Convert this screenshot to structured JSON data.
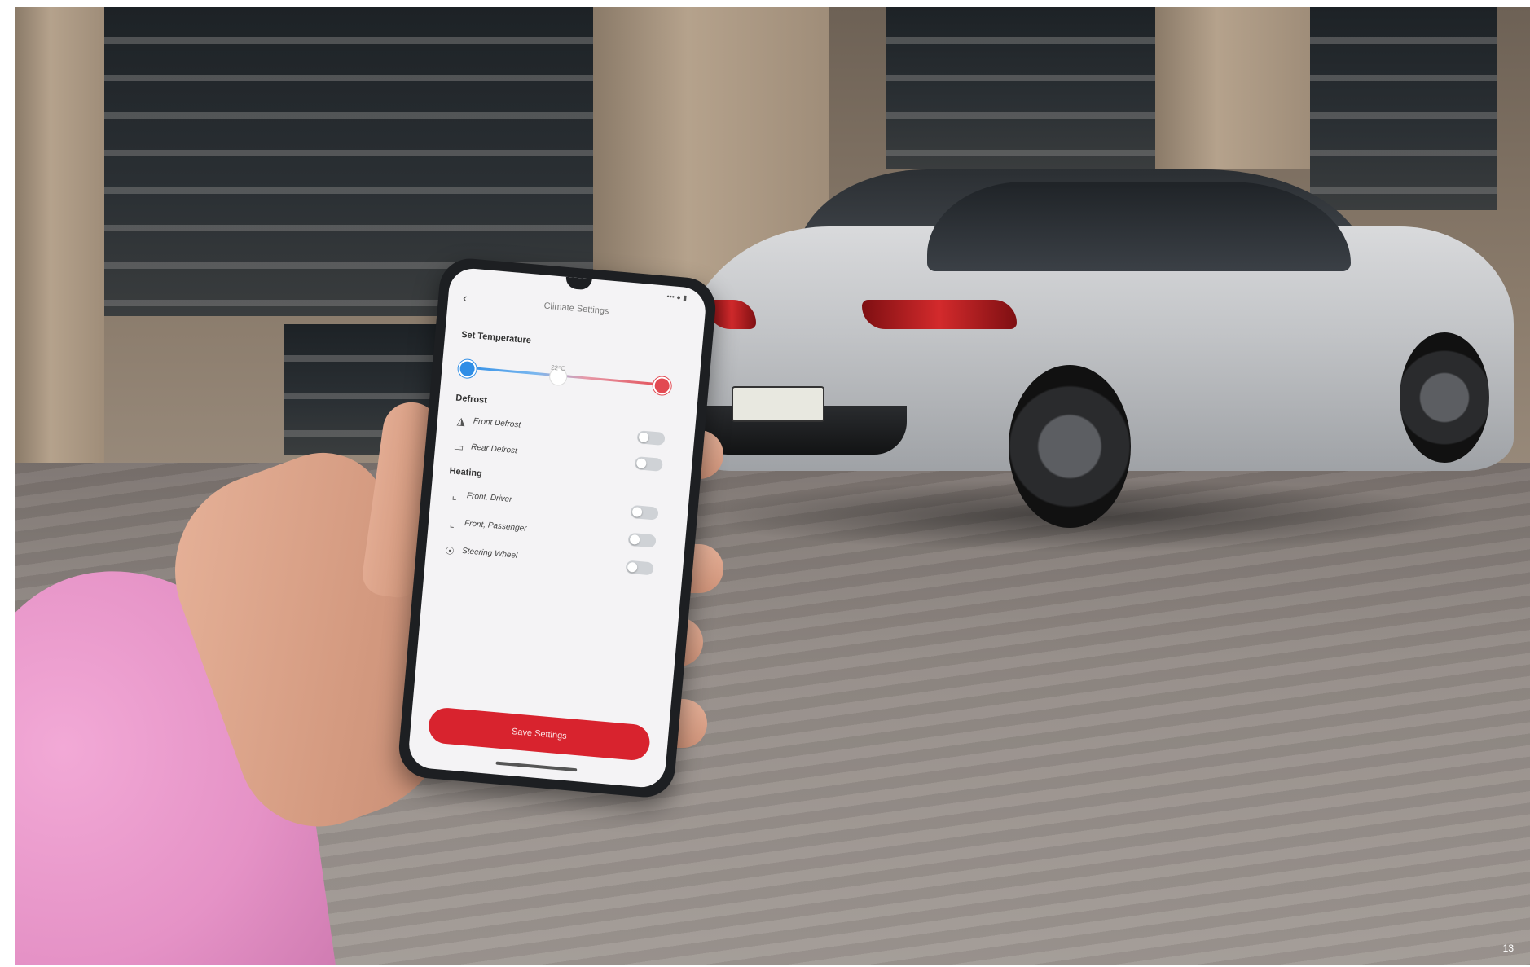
{
  "screen": {
    "status_icons": "••• ● ▮",
    "back_icon": "chevron-left-icon",
    "title": "Climate Settings",
    "temperature": {
      "label": "Set Temperature",
      "value_text": "22°C"
    },
    "defrost": {
      "label": "Defrost",
      "items": [
        {
          "icon": "windshield-icon",
          "label": "Front Defrost",
          "on": false
        },
        {
          "icon": "rear-window-icon",
          "label": "Rear Defrost",
          "on": false
        }
      ]
    },
    "heating": {
      "label": "Heating",
      "items": [
        {
          "icon": "seat-icon",
          "label": "Front, Driver",
          "on": false
        },
        {
          "icon": "seat-icon",
          "label": "Front, Passenger",
          "on": false
        },
        {
          "icon": "steering-wheel-icon",
          "label": "Steering Wheel",
          "on": false
        }
      ]
    },
    "save_button": "Save Settings",
    "colors": {
      "accent": "#d8232e",
      "cold": "#2f8ee6",
      "hot": "#e24a52"
    }
  },
  "page_number": "13"
}
